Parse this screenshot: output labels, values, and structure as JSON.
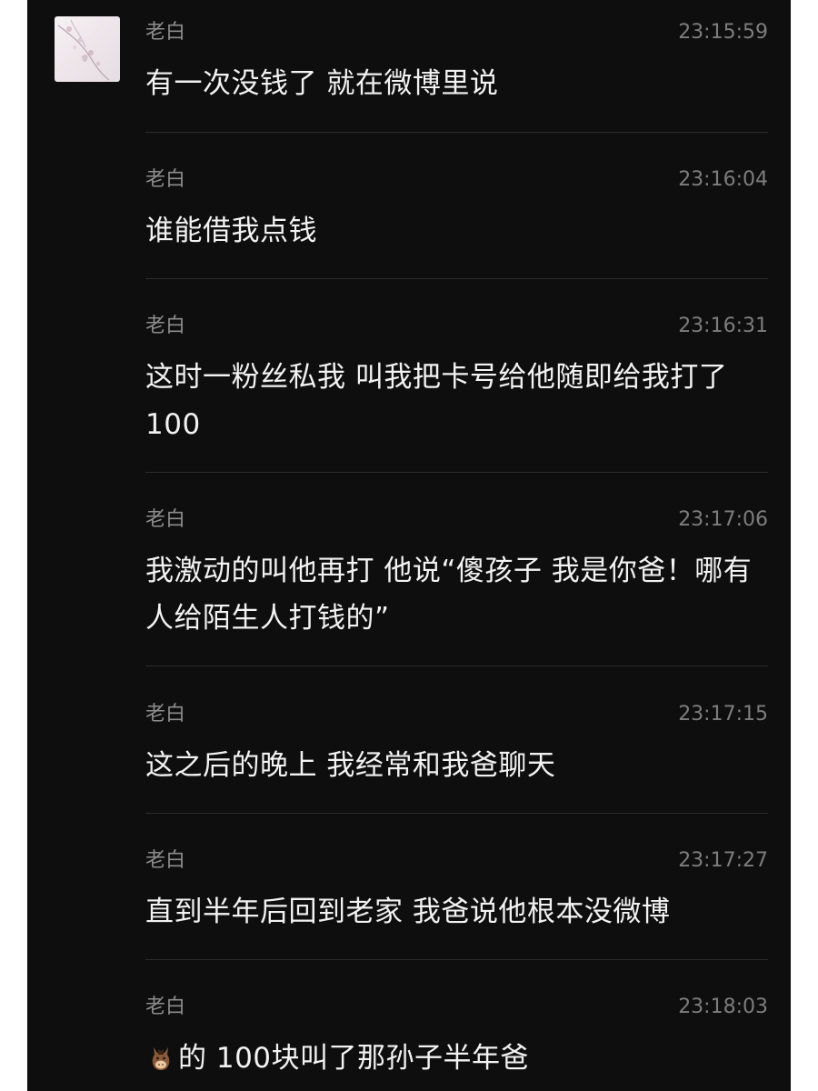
{
  "messages": [
    {
      "sender": "老白",
      "time": "23:15:59",
      "text": "有一次没钱了 就在微博里说"
    },
    {
      "sender": "老白",
      "time": "23:16:04",
      "text": "谁能借我点钱"
    },
    {
      "sender": "老白",
      "time": "23:16:31",
      "text": "这时一粉丝私我 叫我把卡号给他随即给我打了100"
    },
    {
      "sender": "老白",
      "time": "23:17:06",
      "text": "我激动的叫他再打 他说“傻孩子 我是你爸！哪有人给陌生人打钱的”"
    },
    {
      "sender": "老白",
      "time": "23:17:15",
      "text": "这之后的晚上 我经常和我爸聊天"
    },
    {
      "sender": "老白",
      "time": "23:17:27",
      "text": "直到半年后回到老家 我爸说他根本没微博"
    },
    {
      "sender": "老白",
      "time": "23:18:03",
      "text": "的 100块叫了那孙子半年爸",
      "emoji": "horse-face-icon"
    }
  ],
  "colors": {
    "background": "#0e0e0e",
    "text": "#f2f2f2",
    "meta": "#8d8d8d",
    "divider": "#2b2b2b"
  }
}
